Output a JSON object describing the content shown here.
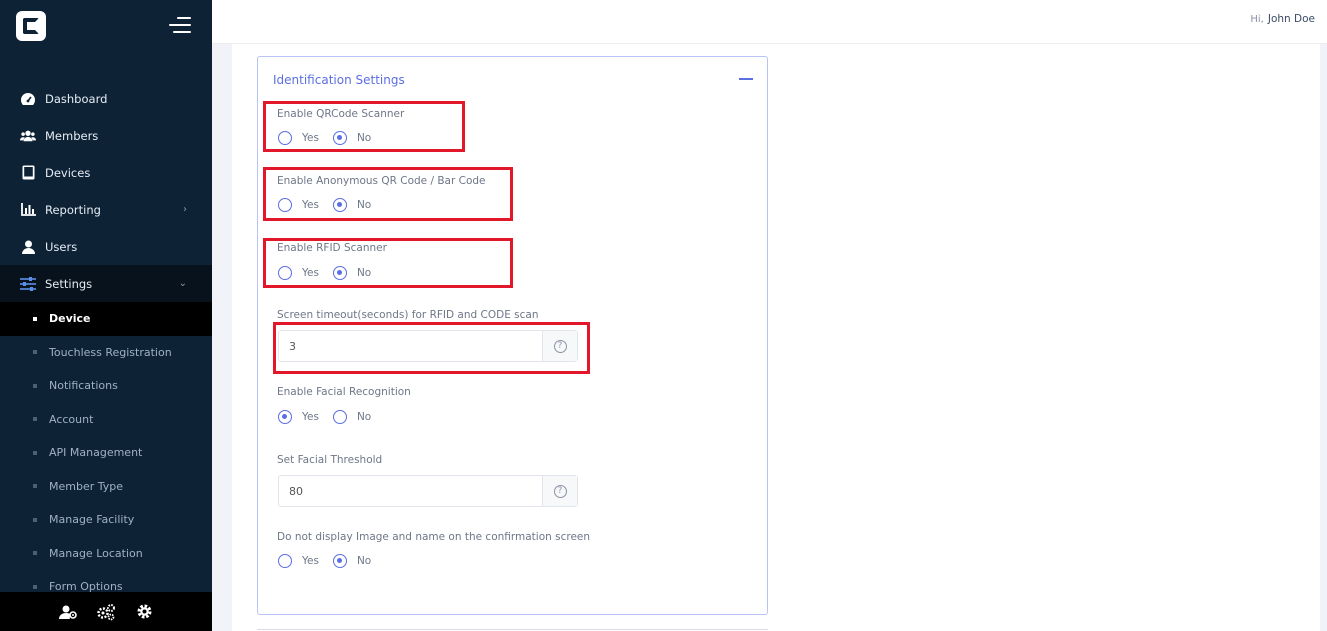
{
  "user": {
    "greeting": "Hi,",
    "name": "John Doe"
  },
  "sidebar": {
    "items": [
      {
        "label": "Dashboard",
        "icon": "dashboard-icon"
      },
      {
        "label": "Members",
        "icon": "members-icon"
      },
      {
        "label": "Devices",
        "icon": "tablet-icon"
      },
      {
        "label": "Reporting",
        "icon": "chart-icon"
      },
      {
        "label": "Users",
        "icon": "user-icon"
      },
      {
        "label": "Settings",
        "icon": "sliders-icon"
      }
    ],
    "settings_subitems": [
      "Device",
      "Touchless Registration",
      "Notifications",
      "Account",
      "API Management",
      "Member Type",
      "Manage Facility",
      "Manage Location",
      "Form Options"
    ],
    "active_subitem": "Device",
    "bottom_icons": [
      "user-settings-icon",
      "cogs-icon",
      "gear-icon"
    ]
  },
  "card": {
    "title": "Identification Settings",
    "fields": {
      "qr": {
        "label": "Enable QRCode Scanner",
        "yes": "Yes",
        "no": "No",
        "value": "No"
      },
      "anon": {
        "label": "Enable Anonymous QR Code / Bar Code",
        "yes": "Yes",
        "no": "No",
        "value": "No"
      },
      "rfid": {
        "label": "Enable RFID Scanner",
        "yes": "Yes",
        "no": "No",
        "value": "No"
      },
      "timeout": {
        "label": "Screen timeout(seconds) for RFID and CODE scan",
        "value": "3"
      },
      "facial": {
        "label": "Enable Facial Recognition",
        "yes": "Yes",
        "no": "No",
        "value": "Yes"
      },
      "threshold": {
        "label": "Set Facial Threshold",
        "value": "80"
      },
      "hide_image": {
        "label": "Do not display Image and name on the confirmation screen",
        "yes": "Yes",
        "no": "No",
        "value": "No"
      }
    }
  },
  "colors": {
    "sidebar": "#0e2236",
    "accent": "#5b6ee3",
    "highlight": "#e3172a"
  }
}
